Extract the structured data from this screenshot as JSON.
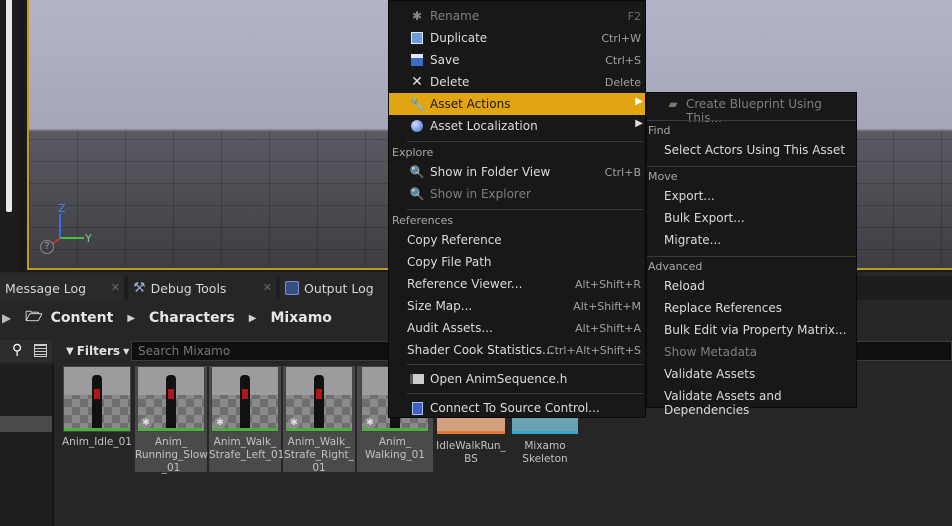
{
  "viewport": {
    "axes": {
      "z": "Z",
      "y": "Y"
    }
  },
  "tabs": [
    {
      "label": "Message Log"
    },
    {
      "label": "Debug Tools"
    },
    {
      "label": "Output Log"
    }
  ],
  "breadcrumb": [
    "Content",
    "Characters",
    "Mixamo"
  ],
  "filters": {
    "label": "Filters",
    "search_placeholder": "Search Mixamo"
  },
  "assets": [
    {
      "label": "Anim_Idle_01"
    },
    {
      "label": "Anim_ Running_Slow _01"
    },
    {
      "label": "Anim_Walk_ Strafe_Left_01"
    },
    {
      "label": "Anim_Walk_ Strafe_Right_ 01"
    },
    {
      "label": "Anim_ Walking_01"
    },
    {
      "label": "IdleWalkRun_ BS"
    },
    {
      "label": "Mixamo Skeleton"
    }
  ],
  "context_menu": {
    "items_top": [
      {
        "label": "Rename",
        "shortcut": "F2"
      },
      {
        "label": "Duplicate",
        "shortcut": "Ctrl+W"
      },
      {
        "label": "Save",
        "shortcut": "Ctrl+S"
      },
      {
        "label": "Delete",
        "shortcut": "Delete"
      },
      {
        "label": "Asset Actions"
      },
      {
        "label": "Asset Localization"
      }
    ],
    "explore": {
      "header": "Explore",
      "items": [
        {
          "label": "Show in Folder View",
          "shortcut": "Ctrl+B"
        },
        {
          "label": "Show in Explorer"
        }
      ]
    },
    "references": {
      "header": "References",
      "items": [
        {
          "label": "Copy Reference"
        },
        {
          "label": "Copy File Path"
        },
        {
          "label": "Reference Viewer...",
          "shortcut": "Alt+Shift+R"
        },
        {
          "label": "Size Map...",
          "shortcut": "Alt+Shift+M"
        },
        {
          "label": "Audit Assets...",
          "shortcut": "Alt+Shift+A"
        },
        {
          "label": "Shader Cook Statistics...",
          "shortcut": "Ctrl+Alt+Shift+S"
        }
      ]
    },
    "open_source": {
      "label": "Open AnimSequence.h"
    },
    "source_control": {
      "label": "Connect To Source Control..."
    }
  },
  "submenu": {
    "create_blueprint": {
      "label": "Create Blueprint Using This..."
    },
    "find": {
      "header": "Find",
      "items": [
        {
          "label": "Select Actors Using This Asset"
        }
      ]
    },
    "move": {
      "header": "Move",
      "items": [
        {
          "label": "Export..."
        },
        {
          "label": "Bulk Export..."
        },
        {
          "label": "Migrate..."
        }
      ]
    },
    "advanced": {
      "header": "Advanced",
      "items": [
        {
          "label": "Reload"
        },
        {
          "label": "Replace References"
        },
        {
          "label": "Bulk Edit via Property Matrix..."
        },
        {
          "label": "Show Metadata"
        },
        {
          "label": "Validate Assets"
        },
        {
          "label": "Validate Assets and Dependencies"
        }
      ]
    }
  },
  "colors": {
    "highlight": "#e0a510",
    "menu_bg": "#181818",
    "selection": "#4a4a4a"
  }
}
